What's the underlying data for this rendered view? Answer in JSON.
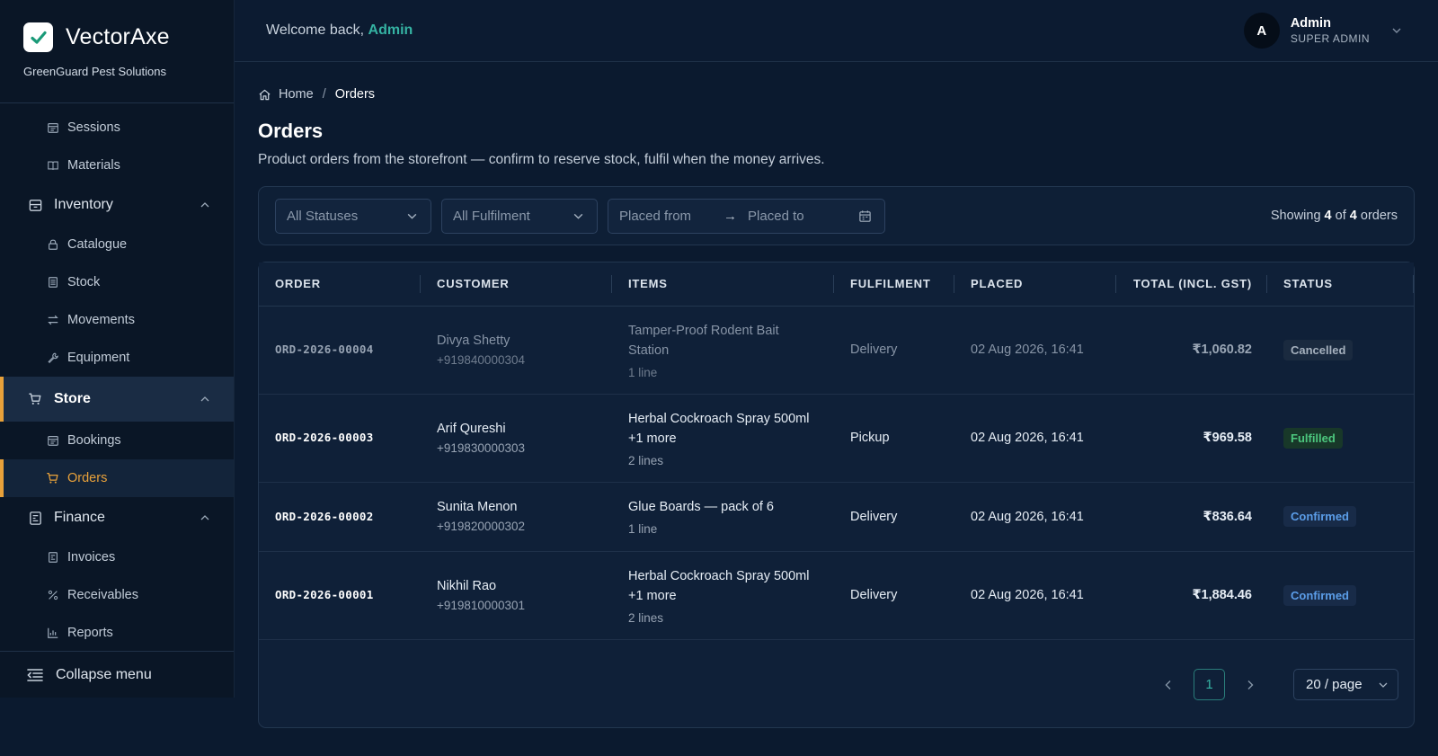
{
  "brand": {
    "name": "VectorAxe",
    "company": "GreenGuard Pest Solutions"
  },
  "sidebar": {
    "items": [
      {
        "type": "sub",
        "label": "Sessions",
        "icon": "calendar-icon"
      },
      {
        "type": "sub",
        "label": "Materials",
        "icon": "book-icon"
      },
      {
        "type": "group",
        "label": "Inventory",
        "icon": "box-icon"
      },
      {
        "type": "sub",
        "label": "Catalogue",
        "icon": "lock-icon"
      },
      {
        "type": "sub",
        "label": "Stock",
        "icon": "list-icon"
      },
      {
        "type": "sub",
        "label": "Movements",
        "icon": "swap-icon"
      },
      {
        "type": "sub",
        "label": "Equipment",
        "icon": "wrench-icon"
      },
      {
        "type": "group",
        "label": "Store",
        "icon": "cart-icon",
        "active": true
      },
      {
        "type": "sub",
        "label": "Bookings",
        "icon": "calendar-icon"
      },
      {
        "type": "sub",
        "label": "Orders",
        "icon": "cart-icon",
        "active": true
      },
      {
        "type": "group",
        "label": "Finance",
        "icon": "file-icon"
      },
      {
        "type": "sub",
        "label": "Invoices",
        "icon": "invoice-icon"
      },
      {
        "type": "sub",
        "label": "Receivables",
        "icon": "percent-icon"
      },
      {
        "type": "sub",
        "label": "Reports",
        "icon": "bar-chart-icon"
      }
    ],
    "collapse_label": "Collapse menu"
  },
  "header": {
    "welcome_prefix": "Welcome back,",
    "welcome_name": "Admin",
    "user_initial": "A",
    "user_name": "Admin",
    "user_role": "SUPER ADMIN"
  },
  "breadcrumb": {
    "home": "Home",
    "sep": "/",
    "current": "Orders"
  },
  "page": {
    "title": "Orders",
    "description": "Product orders from the storefront — confirm to reserve stock, fulfil when the money arrives."
  },
  "filters": {
    "status": "All Statuses",
    "fulfilment": "All Fulfilment",
    "placed_from": "Placed from",
    "placed_to": "Placed to",
    "showing_prefix": "Showing",
    "showing_count": "4",
    "showing_of": "of",
    "showing_total": "4",
    "showing_suffix": "orders"
  },
  "table": {
    "columns": [
      "ORDER",
      "CUSTOMER",
      "ITEMS",
      "FULFILMENT",
      "PLACED",
      "TOTAL (INCL. GST)",
      "STATUS"
    ],
    "rows": [
      {
        "order": "ORD-2026-00004",
        "customer": "Divya Shetty",
        "phone": "+919840000304",
        "item": "Tamper-Proof Rodent Bait Station",
        "lines": "1 line",
        "fulfilment": "Delivery",
        "placed": "02 Aug 2026, 16:41",
        "total": "₹1,060.82",
        "status": "Cancelled",
        "status_kind": "cancel",
        "muted": true,
        "height": 98
      },
      {
        "order": "ORD-2026-00003",
        "customer": "Arif Qureshi",
        "phone": "+919830000303",
        "item": "Herbal Cockroach Spray 500ml +1 more",
        "lines": "2 lines",
        "fulfilment": "Pickup",
        "placed": "02 Aug 2026, 16:41",
        "total": "₹969.58",
        "status": "Fulfilled",
        "status_kind": "fulfilled",
        "muted": false,
        "height": 98
      },
      {
        "order": "ORD-2026-00002",
        "customer": "Sunita Menon",
        "phone": "+919820000302",
        "item": "Glue Boards — pack of 6",
        "lines": "1 line",
        "fulfilment": "Delivery",
        "placed": "02 Aug 2026, 16:41",
        "total": "₹836.64",
        "status": "Confirmed",
        "status_kind": "confirmed",
        "muted": false,
        "height": 77
      },
      {
        "order": "ORD-2026-00001",
        "customer": "Nikhil Rao",
        "phone": "+919810000301",
        "item": "Herbal Cockroach Spray 500ml +1 more",
        "lines": "2 lines",
        "fulfilment": "Delivery",
        "placed": "02 Aug 2026, 16:41",
        "total": "₹1,884.46",
        "status": "Confirmed",
        "status_kind": "confirmed",
        "muted": false,
        "height": 98
      }
    ]
  },
  "pagination": {
    "current": "1",
    "page_size": "20 / page"
  },
  "colors": {
    "accent": "#e8a13a",
    "teal": "#35b3a3",
    "bg": "#0b1a2f"
  }
}
